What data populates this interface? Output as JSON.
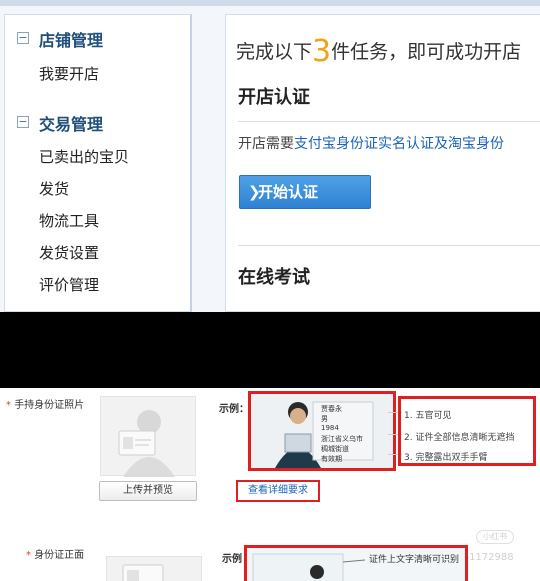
{
  "sidebar": {
    "sections": [
      {
        "title": "店铺管理",
        "toggle": "−",
        "items": [
          "我要开店"
        ]
      },
      {
        "title": "交易管理",
        "toggle": "−",
        "items": [
          "已卖出的宝贝",
          "发货",
          "物流工具",
          "发货设置",
          "评价管理"
        ]
      }
    ]
  },
  "main": {
    "task_prefix": "完成以下",
    "task_count": "3",
    "task_suffix": "件任务，即可成功开店",
    "open_heading": "开店认证",
    "desc_prefix": "开店需要",
    "desc_link": "支付宝身份证实名认证及淘宝身份",
    "start_button": "开始认证",
    "start_arrow": "❯",
    "exam_heading": "在线考试"
  },
  "form": {
    "handheld_label": "手持身份证照片",
    "front_label": "身份证正面",
    "required_mark": "*",
    "example_label": "示例：",
    "example_label2": "示例",
    "upload_button": "上传并预览",
    "detail_link": "查看详细要求",
    "sample_card": [
      "贾春永",
      "男",
      "1984",
      "浙江省义乌市",
      "稠城街道",
      "有效期"
    ],
    "rules": [
      "1. 五官可见",
      "2. 证件全部信息清晰无遮挡",
      "3. 完整露出双手手臂"
    ],
    "front_note": "证件上文字清晰可识别",
    "watermark_text": "小红书号：1661172988",
    "watermark_badge": "小红书"
  },
  "colors": {
    "accent_orange": "#f2a116",
    "link_blue": "#1a63b8",
    "highlight_red": "#e02020",
    "button_blue": "#3a8cdb",
    "sidebar_title": "#1f4e7a"
  }
}
